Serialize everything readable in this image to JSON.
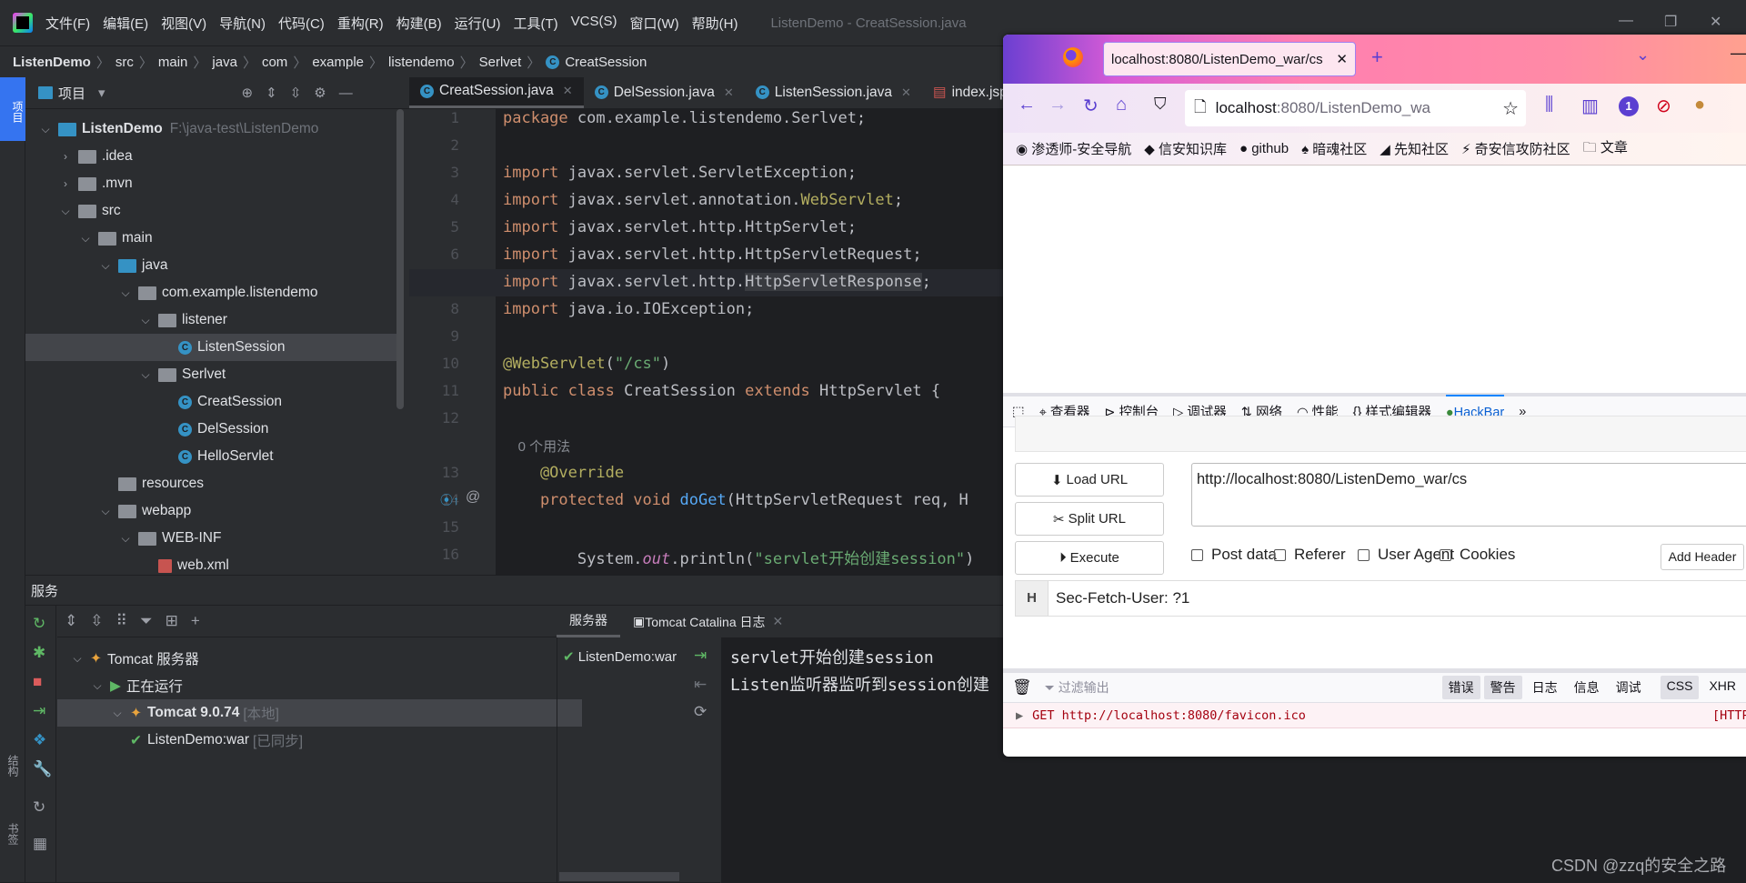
{
  "titlebar": {
    "menus": [
      "文件(F)",
      "编辑(E)",
      "视图(V)",
      "导航(N)",
      "代码(C)",
      "重构(R)",
      "构建(B)",
      "运行(U)",
      "工具(T)",
      "VCS(S)",
      "窗口(W)",
      "帮助(H)"
    ],
    "window_title": "ListenDemo - CreatSession.java"
  },
  "breadcrumb": [
    "ListenDemo",
    "src",
    "main",
    "java",
    "com",
    "example",
    "listendemo",
    "Serlvet",
    "CreatSession"
  ],
  "left_strip": {
    "project_label": "项目",
    "structure_label": "结构",
    "bookmarks_label": "书签"
  },
  "project": {
    "title": "项目",
    "tree": [
      {
        "label": "ListenDemo",
        "extra": "F:\\java-test\\ListenDemo",
        "depth": 0,
        "icon": "module",
        "chev": "down",
        "bold": true
      },
      {
        "label": ".idea",
        "depth": 1,
        "icon": "folder",
        "chev": "right"
      },
      {
        "label": ".mvn",
        "depth": 1,
        "icon": "folder",
        "chev": "right"
      },
      {
        "label": "src",
        "depth": 1,
        "icon": "folder",
        "chev": "down"
      },
      {
        "label": "main",
        "depth": 2,
        "icon": "folder",
        "chev": "down"
      },
      {
        "label": "java",
        "depth": 3,
        "icon": "source-folder",
        "chev": "down"
      },
      {
        "label": "com.example.listendemo",
        "depth": 4,
        "icon": "package",
        "chev": "down"
      },
      {
        "label": "listener",
        "depth": 5,
        "icon": "package",
        "chev": "down"
      },
      {
        "label": "ListenSession",
        "depth": 6,
        "icon": "class",
        "selected": true
      },
      {
        "label": "Serlvet",
        "depth": 5,
        "icon": "package",
        "chev": "down"
      },
      {
        "label": "CreatSession",
        "depth": 6,
        "icon": "class"
      },
      {
        "label": "DelSession",
        "depth": 6,
        "icon": "class"
      },
      {
        "label": "HelloServlet",
        "depth": 6,
        "icon": "class"
      },
      {
        "label": "resources",
        "depth": 3,
        "icon": "resources-folder"
      },
      {
        "label": "webapp",
        "depth": 3,
        "icon": "web-folder",
        "chev": "down"
      },
      {
        "label": "WEB-INF",
        "depth": 4,
        "icon": "folder",
        "chev": "down"
      },
      {
        "label": "web.xml",
        "depth": 5,
        "icon": "xml-file"
      }
    ]
  },
  "editor": {
    "tabs": [
      {
        "label": "CreatSession.java",
        "active": true,
        "icon": "class"
      },
      {
        "label": "DelSession.java",
        "icon": "class"
      },
      {
        "label": "ListenSession.java",
        "icon": "class"
      },
      {
        "label": "index.jsp",
        "icon": "jsp"
      }
    ],
    "current_line": 7,
    "lines": [
      {
        "n": "1",
        "t": [
          [
            "package",
            "k"
          ],
          [
            " com.example.listendemo.Serlvet;",
            ""
          ]
        ]
      },
      {
        "n": "2",
        "t": []
      },
      {
        "n": "3",
        "t": [
          [
            "import",
            "k"
          ],
          [
            " javax.servlet.ServletException;",
            ""
          ]
        ]
      },
      {
        "n": "4",
        "t": [
          [
            "import",
            "k"
          ],
          [
            " javax.servlet.annotation.",
            ""
          ],
          [
            "WebServlet",
            "a"
          ],
          [
            ";",
            ""
          ]
        ]
      },
      {
        "n": "5",
        "t": [
          [
            "import",
            "k"
          ],
          [
            " javax.servlet.http.HttpServlet;",
            ""
          ]
        ]
      },
      {
        "n": "6",
        "t": [
          [
            "import",
            "k"
          ],
          [
            " javax.servlet.http.HttpServletRequest;",
            ""
          ]
        ]
      },
      {
        "n": "7",
        "t": [
          [
            "import",
            "k"
          ],
          [
            " javax.servlet.http.",
            ""
          ],
          [
            "HttpServletResponse",
            "hl"
          ],
          [
            ";",
            ""
          ]
        ]
      },
      {
        "n": "8",
        "t": [
          [
            "import",
            "k"
          ],
          [
            " java.io.IOException;",
            ""
          ]
        ]
      },
      {
        "n": "9",
        "t": []
      },
      {
        "n": "10",
        "t": [
          [
            "@WebServlet",
            "a"
          ],
          [
            "(",
            ""
          ],
          [
            "\"/cs\"",
            "s"
          ],
          [
            ")",
            ""
          ]
        ]
      },
      {
        "n": "11",
        "t": [
          [
            "public class",
            "k"
          ],
          [
            " CreatSession ",
            ""
          ],
          [
            "extends",
            "k"
          ],
          [
            " HttpServlet {",
            ""
          ]
        ]
      },
      {
        "n": "12",
        "t": []
      },
      {
        "n": "",
        "t": [
          [
            "    0 个用法",
            "inlay"
          ]
        ]
      },
      {
        "n": "13",
        "t": [
          [
            "    @Override",
            "a"
          ]
        ]
      },
      {
        "n": "14",
        "t": [
          [
            "    protected void",
            "k"
          ],
          [
            " ",
            ""
          ],
          [
            "doGet",
            "m"
          ],
          [
            "(HttpServletRequest req, H",
            ""
          ]
        ]
      },
      {
        "n": "15",
        "t": []
      },
      {
        "n": "16",
        "t": [
          [
            "        System.",
            ""
          ],
          [
            "out",
            "o"
          ],
          [
            ".println(",
            ""
          ],
          [
            "\"servlet开始创建session\"",
            "s"
          ],
          [
            ")",
            ""
          ]
        ]
      }
    ]
  },
  "services": {
    "title": "服务",
    "tree": [
      {
        "label": "Tomcat 服务器",
        "depth": 0
      },
      {
        "label": "正在运行",
        "depth": 1
      },
      {
        "label": "Tomcat 9.0.74",
        "extra": "[本地]",
        "depth": 2,
        "selected": true
      },
      {
        "label": "ListenDemo:war",
        "extra": "[已同步]",
        "depth": 3
      }
    ],
    "tabs": [
      {
        "label": "服务器",
        "active": true
      },
      {
        "label": "Tomcat Catalina 日志"
      }
    ],
    "deployment": "ListenDemo:war",
    "output": [
      "servlet开始创建session",
      "Listen监听器监听到session创建"
    ]
  },
  "browser": {
    "tab_title": "localhost:8080/ListenDemo_war/cs",
    "url_host": "localhost",
    "url_rest": ":8080/ListenDemo_wa",
    "badge": "1",
    "bookmarks": [
      "渗透师-安全导航",
      "信安知识库",
      "github",
      "暗魂社区",
      "先知社区",
      "奇安信攻防社区",
      "文章"
    ],
    "devtools_tabs": [
      "查看器",
      "控制台",
      "调试器",
      "网络",
      "性能",
      "样式编辑器",
      "HackBar"
    ],
    "hackbar": {
      "load_url": "Load URL",
      "split_url": "Split URL",
      "execute": "Execute",
      "url_value": "http://localhost:8080/ListenDemo_war/cs",
      "checks": [
        "Post data",
        "Referer",
        "User Agent",
        "Cookies"
      ],
      "add_header": "Add Header",
      "header_key": "H",
      "header_value": "Sec-Fetch-User: ?1"
    },
    "console": {
      "filter_placeholder": "过滤输出",
      "filters": [
        "错误",
        "警告",
        "日志",
        "信息",
        "调试"
      ],
      "extra_filters": [
        "CSS",
        "XHR"
      ],
      "log": "GET http://localhost:8080/favicon.ico",
      "log_tag": "[HTTP"
    }
  },
  "watermark": "CSDN @zzq的安全之路",
  "colors": {
    "keyword": "#cf8e6d",
    "annotation": "#b3ae60",
    "string": "#6aab73",
    "method": "#56a8f5",
    "accent": "#3574f0",
    "hackbar_active": "#0a60d2"
  }
}
